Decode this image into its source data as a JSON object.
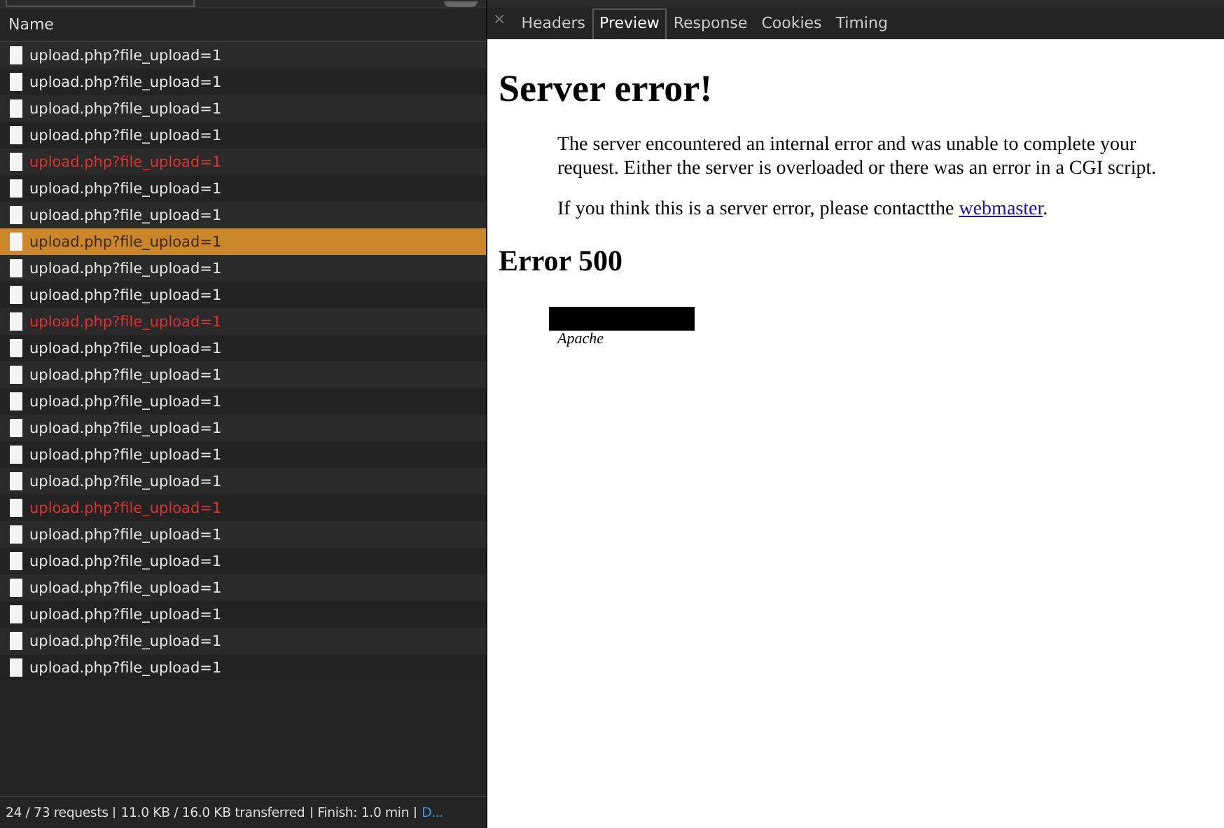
{
  "requests": {
    "column": "Name",
    "rows": [
      {
        "name": "upload.php?file_upload=1",
        "error": false,
        "selected": false
      },
      {
        "name": "upload.php?file_upload=1",
        "error": false,
        "selected": false
      },
      {
        "name": "upload.php?file_upload=1",
        "error": false,
        "selected": false
      },
      {
        "name": "upload.php?file_upload=1",
        "error": false,
        "selected": false
      },
      {
        "name": "upload.php?file_upload=1",
        "error": true,
        "selected": false
      },
      {
        "name": "upload.php?file_upload=1",
        "error": false,
        "selected": false
      },
      {
        "name": "upload.php?file_upload=1",
        "error": false,
        "selected": false
      },
      {
        "name": "upload.php?file_upload=1",
        "error": false,
        "selected": true
      },
      {
        "name": "upload.php?file_upload=1",
        "error": false,
        "selected": false
      },
      {
        "name": "upload.php?file_upload=1",
        "error": false,
        "selected": false
      },
      {
        "name": "upload.php?file_upload=1",
        "error": true,
        "selected": false
      },
      {
        "name": "upload.php?file_upload=1",
        "error": false,
        "selected": false
      },
      {
        "name": "upload.php?file_upload=1",
        "error": false,
        "selected": false
      },
      {
        "name": "upload.php?file_upload=1",
        "error": false,
        "selected": false
      },
      {
        "name": "upload.php?file_upload=1",
        "error": false,
        "selected": false
      },
      {
        "name": "upload.php?file_upload=1",
        "error": false,
        "selected": false
      },
      {
        "name": "upload.php?file_upload=1",
        "error": false,
        "selected": false
      },
      {
        "name": "upload.php?file_upload=1",
        "error": true,
        "selected": false
      },
      {
        "name": "upload.php?file_upload=1",
        "error": false,
        "selected": false
      },
      {
        "name": "upload.php?file_upload=1",
        "error": false,
        "selected": false
      },
      {
        "name": "upload.php?file_upload=1",
        "error": false,
        "selected": false
      },
      {
        "name": "upload.php?file_upload=1",
        "error": false,
        "selected": false
      },
      {
        "name": "upload.php?file_upload=1",
        "error": false,
        "selected": false
      },
      {
        "name": "upload.php?file_upload=1",
        "error": false,
        "selected": false
      }
    ]
  },
  "status_bar": {
    "requests": "24 / 73 requests",
    "transferred": "11.0 KB / 16.0 KB transferred",
    "finish": "Finish: 1.0 min",
    "more": "D..."
  },
  "detail": {
    "close": "×",
    "tabs": [
      {
        "label": "Headers",
        "selected": false
      },
      {
        "label": "Preview",
        "selected": true
      },
      {
        "label": "Response",
        "selected": false
      },
      {
        "label": "Cookies",
        "selected": false
      },
      {
        "label": "Timing",
        "selected": false
      }
    ],
    "preview": {
      "title": "Server error!",
      "message": "The server encountered an internal error and was unable to complete your request. Either the server is overloaded or there was an error in a CGI script.",
      "contact_before": "If you think this is a server error, please contactthe ",
      "contact_link": "webmaster",
      "contact_after": ".",
      "code": "Error 500",
      "server": "Apache"
    }
  }
}
